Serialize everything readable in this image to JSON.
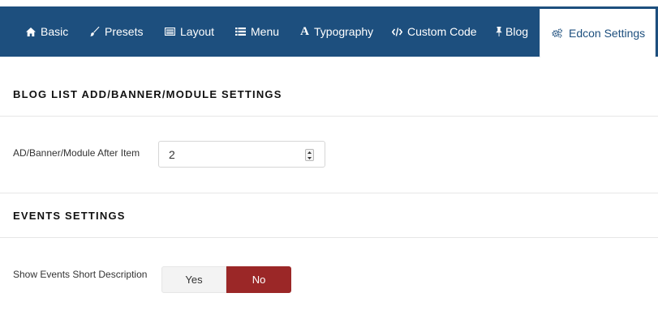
{
  "tabs": [
    {
      "label": "Basic",
      "icon": "home-icon"
    },
    {
      "label": "Presets",
      "icon": "paint-brush-icon"
    },
    {
      "label": "Layout",
      "icon": "layout-icon"
    },
    {
      "label": "Menu",
      "icon": "list-icon"
    },
    {
      "label": "Typography",
      "icon": "font-icon"
    },
    {
      "label": "Custom Code",
      "icon": "code-icon"
    },
    {
      "label": "Blog",
      "icon": "pushpin-icon"
    },
    {
      "label": "Edcon Settings",
      "icon": "cogs-icon",
      "active": true
    }
  ],
  "blog_section": {
    "title": "BLOG LIST ADD/BANNER/MODULE SETTINGS",
    "field_label": "AD/Banner/Module After Item",
    "field_value": "2"
  },
  "events_section": {
    "title": "EVENTS SETTINGS",
    "field_label": "Show Events Short Description",
    "yes_label": "Yes",
    "no_label": "No",
    "selected": "No"
  },
  "colors": {
    "tabbar_bg": "#1d4f7e",
    "active_tab_text": "#1d4f7e",
    "toggle_selected": "#9b2727"
  }
}
